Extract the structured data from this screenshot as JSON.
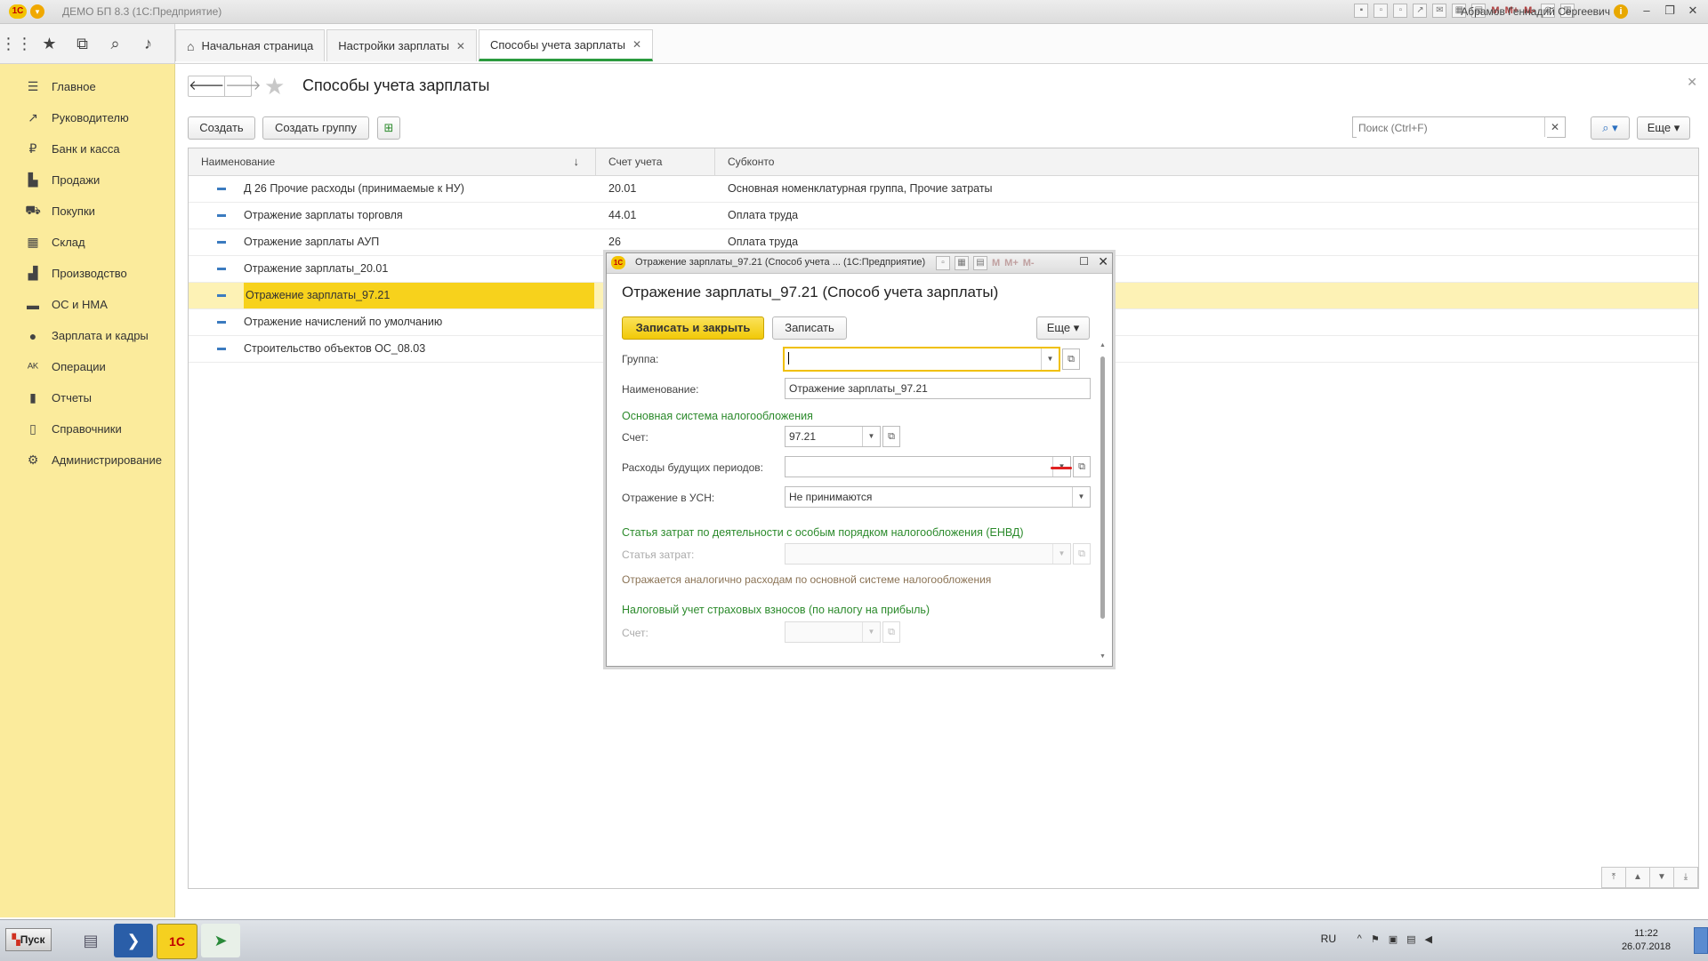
{
  "titlebar": {
    "title": "ДЕМО БП 8.3  (1С:Предприятие)",
    "user": "Абрамов Геннадий Сергеевич",
    "m_labels": [
      "M",
      "M+",
      "M-"
    ]
  },
  "tabs": [
    {
      "label": "Начальная страница"
    },
    {
      "label": "Настройки зарплаты"
    },
    {
      "label": "Способы учета зарплаты"
    }
  ],
  "sidebar": {
    "items": [
      {
        "label": "Главное",
        "icon": "menu-icon"
      },
      {
        "label": "Руководителю",
        "icon": "chart-line-icon"
      },
      {
        "label": "Банк и касса",
        "icon": "ruble-icon"
      },
      {
        "label": "Продажи",
        "icon": "bag-icon"
      },
      {
        "label": "Покупки",
        "icon": "cart-icon"
      },
      {
        "label": "Склад",
        "icon": "warehouse-icon"
      },
      {
        "label": "Производство",
        "icon": "factory-icon"
      },
      {
        "label": "ОС и НМА",
        "icon": "truck-icon"
      },
      {
        "label": "Зарплата и кадры",
        "icon": "person-icon"
      },
      {
        "label": "Операции",
        "icon": "operations-icon"
      },
      {
        "label": "Отчеты",
        "icon": "bar-chart-icon"
      },
      {
        "label": "Справочники",
        "icon": "book-icon"
      },
      {
        "label": "Администрирование",
        "icon": "gear-icon"
      }
    ]
  },
  "main": {
    "title": "Способы учета зарплаты",
    "create_label": "Создать",
    "create_group_label": "Создать группу",
    "search_placeholder": "Поиск (Ctrl+F)",
    "more_label": "Еще",
    "columns": [
      "Наименование",
      "Счет учета",
      "Субконто"
    ],
    "rows": [
      {
        "name": "Д 26 Прочие расходы (принимаемые к НУ)",
        "account": "20.01",
        "subconto": "Основная номенклатурная группа, Прочие затраты"
      },
      {
        "name": "Отражение зарплаты торговля",
        "account": "44.01",
        "subconto": "Оплата труда"
      },
      {
        "name": "Отражение зарплаты АУП",
        "account": "26",
        "subconto": "Оплата труда"
      },
      {
        "name": "Отражение зарплаты_20.01",
        "account": "",
        "subconto": ""
      },
      {
        "name": "Отражение зарплаты_97.21",
        "account": "",
        "subconto": ""
      },
      {
        "name": "Отражение начислений по умолчанию",
        "account": "",
        "subconto": ""
      },
      {
        "name": "Строительство объектов ОС_08.03",
        "account": "",
        "subconto": ""
      }
    ]
  },
  "dialog": {
    "window_title": "Отражение зарплаты_97.21 (Способ учета ...  (1С:Предприятие)",
    "heading": "Отражение зарплаты_97.21 (Способ учета зарплаты)",
    "save_close_label": "Записать и закрыть",
    "save_label": "Записать",
    "more_label": "Еще",
    "group_label": "Группа:",
    "group_value": "",
    "name_label": "Наименование:",
    "name_value": "Отражение зарплаты_97.21",
    "section_main": "Основная система налогообложения",
    "account_label": "Счет:",
    "account_value": "97.21",
    "future_label": "Расходы будущих периодов:",
    "future_value": "",
    "usn_label": "Отражение в УСН:",
    "usn_value": "Не принимаются",
    "section_envd": "Статья затрат по деятельности с особым порядком налогообложения (ЕНВД)",
    "cost_label": "Статья затрат:",
    "note": "Отражается аналогично расходам по основной системе налогообложения",
    "section_insurance": "Налоговый учет страховых взносов (по налогу на прибыль)",
    "ins_account_label": "Счет:",
    "m_labels": [
      "M",
      "M+",
      "M-"
    ]
  },
  "taskbar": {
    "start_label": "Пуск",
    "lang": "RU",
    "time": "11:22",
    "date": "26.07.2018"
  }
}
